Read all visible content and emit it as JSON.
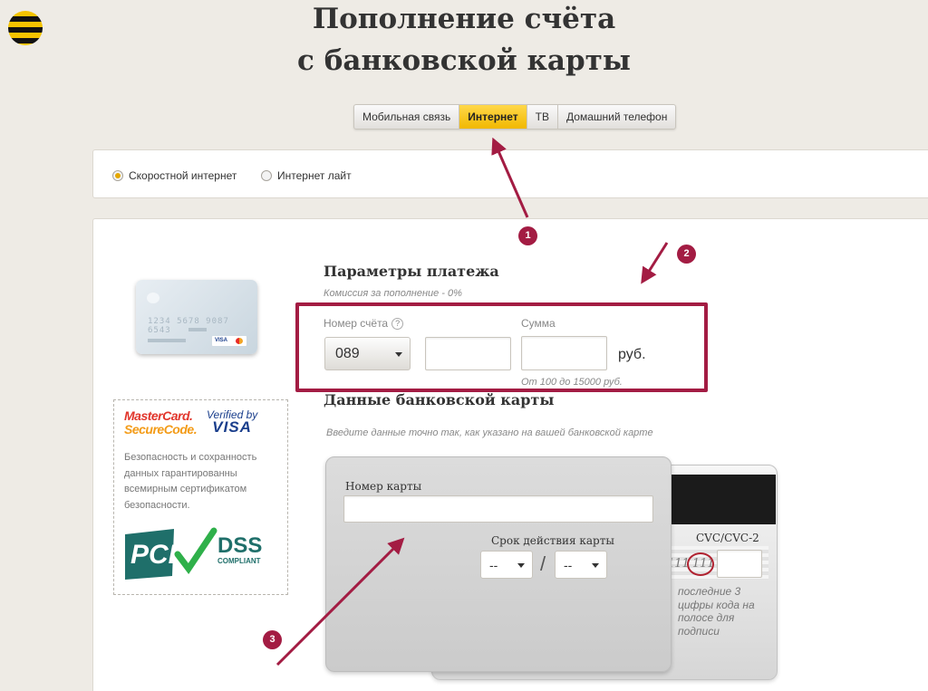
{
  "header": {
    "title_line1": "Пополнение счёта",
    "title_line2": "с банковской карты"
  },
  "tabs": [
    {
      "label": "Мобильная связь",
      "active": false
    },
    {
      "label": "Интернет",
      "active": true
    },
    {
      "label": "ТВ",
      "active": false
    },
    {
      "label": "Домашний телефон",
      "active": false
    }
  ],
  "service_options": [
    {
      "label": "Скоростной интернет",
      "selected": true
    },
    {
      "label": "Интернет лайт",
      "selected": false
    }
  ],
  "sample_card": {
    "number": "1234 5678 9087 6543",
    "brand": "VISA"
  },
  "security": {
    "mastercard_line1": "MasterCard.",
    "mastercard_line2": "SecureCode.",
    "visa_line1": "Verified by",
    "visa_line2": "VISA",
    "text": "Безопасность и сохранность данных гарантированны всемирным сертификатом безопасности.",
    "pci_text": "PCI",
    "dss_text": "DSS",
    "compliant_text": "COMPLIANT"
  },
  "payment": {
    "heading": "Параметры платежа",
    "commission": "Комиссия за пополнение - 0%",
    "account_label": "Номер счёта",
    "help_symbol": "?",
    "account_prefix": "089",
    "account_value": "",
    "amount_label": "Сумма",
    "amount_value": "",
    "currency": "руб.",
    "amount_hint": "От 100 до 15000 руб."
  },
  "card_data": {
    "heading": "Данные банковской карты",
    "hint": "Введите данные точно так, как указано на вашей банковской карте",
    "card_number_label": "Номер карты",
    "card_number_value": "",
    "expiry_label": "Срок действия карты",
    "month_value": "--",
    "year_value": "--",
    "separator": "/",
    "cvc_label": "CVC/CVC-2",
    "cvc_sample_prefix": "111",
    "cvc_sample": "111",
    "cvc_value": "",
    "cvc_note": "последние 3 цифры кода на полосе для подписи"
  },
  "annotations": [
    "1",
    "2",
    "3"
  ],
  "colors": {
    "brand_yellow": "#f5c300",
    "annotation": "#a31c43",
    "background": "#eeebe5"
  }
}
